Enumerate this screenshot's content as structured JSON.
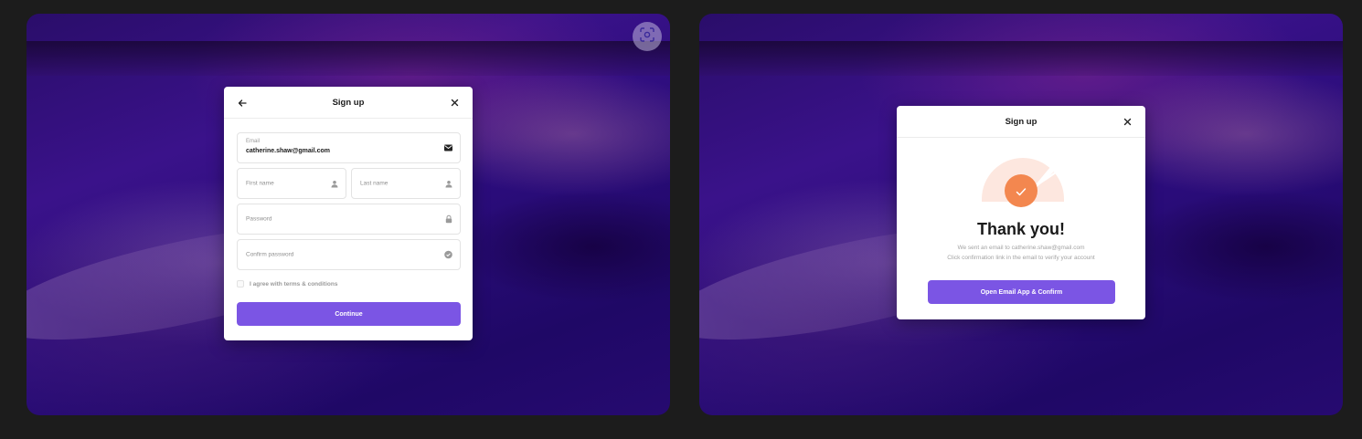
{
  "signup_form": {
    "title": "Sign up",
    "email": {
      "label": "Email",
      "value": "catherine.shaw@gmail.com"
    },
    "first_name": {
      "placeholder": "First name"
    },
    "last_name": {
      "placeholder": "Last name"
    },
    "password": {
      "placeholder": "Password"
    },
    "confirm_password": {
      "placeholder": "Confirm password"
    },
    "terms_label": "I agree with terms & conditions",
    "continue_label": "Continue"
  },
  "confirmation": {
    "title": "Sign up",
    "heading": "Thank you!",
    "line1": "We sent an email to catherine.shaw@gmail.com",
    "line2": "Click confirmation link in the email to verify your account",
    "button_label": "Open Email App & Confirm"
  },
  "icons": {
    "back": "arrow-left-icon",
    "close": "close-icon",
    "email": "envelope-icon",
    "person": "person-icon",
    "lock": "lock-icon",
    "check": "check-circle-icon",
    "scan": "scan-icon",
    "success": "checkmark-icon"
  },
  "colors": {
    "accent": "#7b55e4",
    "success_orange": "#f3874f",
    "success_bg": "#fde7df"
  }
}
